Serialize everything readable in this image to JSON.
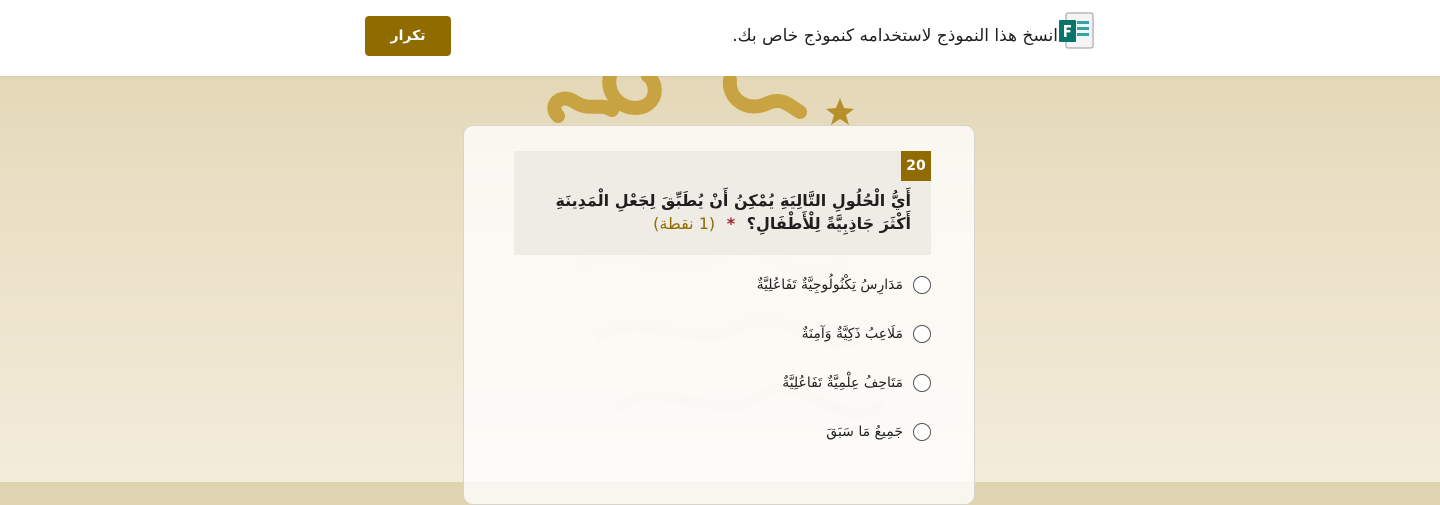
{
  "header": {
    "copy_text": "انسخ هذا النموذج لاستخدامه كنموذج خاص بك.",
    "duplicate_label": "تكرار",
    "logo_icon": "microsoft-forms-icon"
  },
  "question": {
    "number": "20",
    "text": "أَيُّ الْحُلُولِ التَّالِيَةِ يُمْكِنُ أَنْ يُطَبِّقَ لِجَعْلِ الْمَدِينَةِ أَكْثَرَ جَاذِبِيَّةً لِلْأَطْفَالِ؟",
    "required_mark": "*",
    "points": "(1 نقطة)",
    "options": [
      "مَدَارِسُ تِكْنُولُوجِيَّةٌ تَفَاعُلِيَّةٌ",
      "مَلَاعِبُ ذَكِيَّةٌ وَآمِنَةٌ",
      "مَتَاحِفُ عِلْمِيَّةٌ تَفَاعُلِيَّةٌ",
      "جَمِيعُ مَا سَبَقَ"
    ]
  },
  "colors": {
    "accent": "#8f6b00",
    "required": "#a4262c"
  }
}
